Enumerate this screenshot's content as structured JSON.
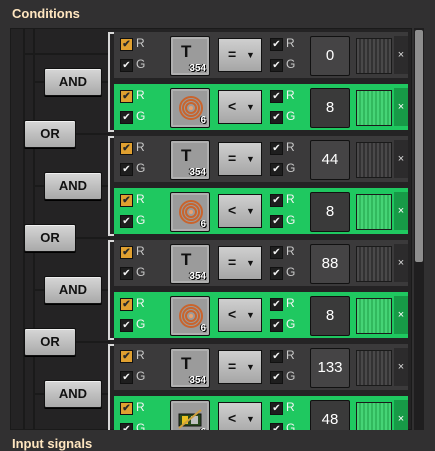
{
  "panel": {
    "title": "Conditions",
    "next_section": "Input signals"
  },
  "logic": {
    "and_label": "AND",
    "or_label": "OR"
  },
  "icons": {
    "signal_t": "signal-T-icon",
    "copper_cable": "copper-cable-icon",
    "electronic_circuit": "circuit-icon",
    "close": "close-icon"
  },
  "checkbox_letters": {
    "r": "R",
    "g": "G"
  },
  "colors": {
    "met": "#1fc860",
    "unmet": "#3b3a3b",
    "checkbox_orange": "#e0a030"
  },
  "conditions": [
    {
      "signal": "T",
      "count": "354",
      "comparator": "=",
      "value": "0",
      "met": false
    },
    {
      "signal": "copper",
      "count": "6",
      "comparator": "<",
      "value": "8",
      "met": true
    },
    {
      "signal": "T",
      "count": "354",
      "comparator": "=",
      "value": "44",
      "met": false
    },
    {
      "signal": "copper",
      "count": "6",
      "comparator": "<",
      "value": "8",
      "met": true
    },
    {
      "signal": "T",
      "count": "354",
      "comparator": "=",
      "value": "88",
      "met": false
    },
    {
      "signal": "copper",
      "count": "6",
      "comparator": "<",
      "value": "8",
      "met": true
    },
    {
      "signal": "T",
      "count": "354",
      "comparator": "=",
      "value": "133",
      "met": false
    },
    {
      "signal": "circuit",
      "count": "6",
      "comparator": "<",
      "value": "48",
      "met": true
    }
  ],
  "close_label": "×"
}
